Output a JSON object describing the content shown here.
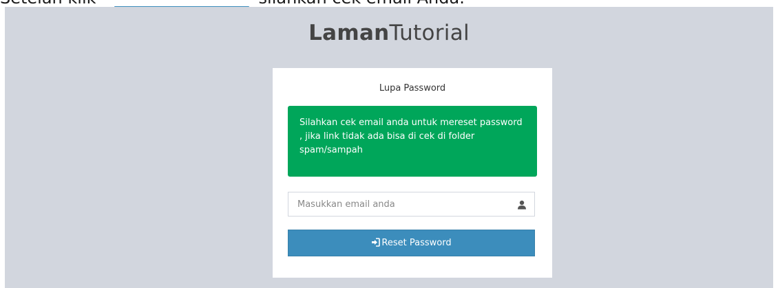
{
  "caption": {
    "before": "Setelah klik",
    "after": "silahkan cek email Anda."
  },
  "logo": {
    "bold": "Laman",
    "light": "Tutorial"
  },
  "box": {
    "title": "Lupa Password",
    "alert_text": "Silahkan cek email anda untuk mereset password , jika link tidak ada bisa di cek di folder spam/sampah",
    "email_placeholder": "Masukkan email anda",
    "email_value": "",
    "reset_label": "Reset Password"
  },
  "icons": {
    "input_icon": "user-icon",
    "button_icon": "sign-in-icon"
  },
  "colors": {
    "background": "#d2d6de",
    "alert_success": "#00a65a",
    "button_primary": "#3c8dbc"
  }
}
